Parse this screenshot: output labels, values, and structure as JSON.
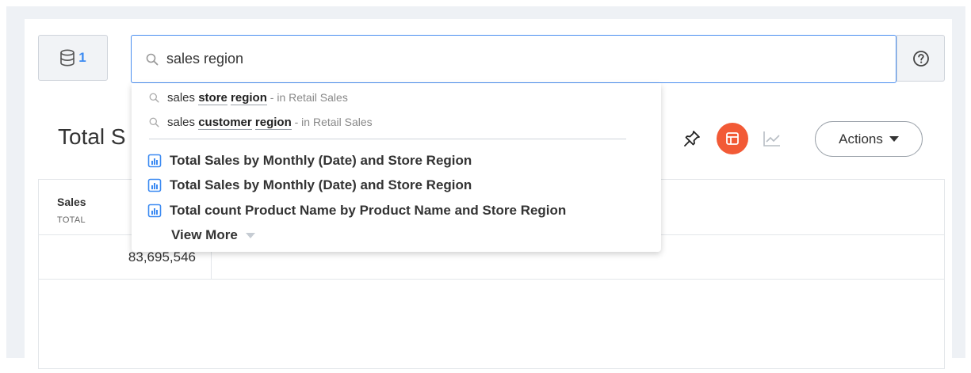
{
  "datasource": {
    "count": "1",
    "icon": "database-icon"
  },
  "search": {
    "value": "sales region",
    "icon": "search-icon"
  },
  "help": {
    "icon": "help-circle-icon"
  },
  "page": {
    "title": "Total S"
  },
  "toolbar": {
    "pin_icon": "pin-icon",
    "table_view_icon": "table-view-icon",
    "chart_view_icon": "line-chart-icon",
    "actions_label": "Actions",
    "accent": "#f25a36"
  },
  "suggestions": {
    "queries": [
      {
        "prefix": "sales ",
        "bold1": "store",
        "mid": " ",
        "bold2": "region",
        "source": " - in Retail Sales"
      },
      {
        "prefix": "sales ",
        "bold1": "customer",
        "mid": " ",
        "bold2": "region",
        "source": " - in Retail Sales"
      }
    ],
    "answers": [
      "Total Sales by Monthly (Date) and Store Region",
      "Total Sales by Monthly (Date) and Store Region",
      "Total count Product Name by Product Name and Store Region"
    ],
    "view_more": "View More"
  },
  "table": {
    "columns": [
      {
        "name": "Sales",
        "aggregation": "TOTAL"
      }
    ],
    "rows": [
      [
        "83,695,546"
      ]
    ]
  }
}
